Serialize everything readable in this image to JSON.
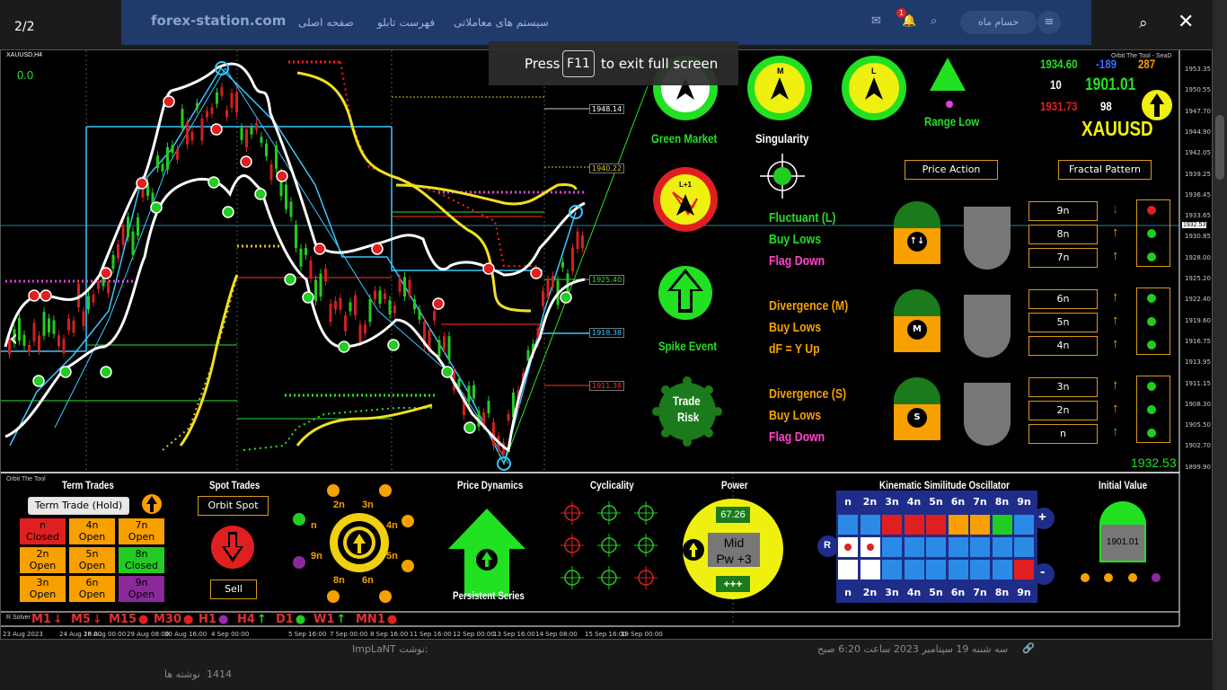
{
  "viewer": {
    "counter": "2/2",
    "fullscreen_press": "Press",
    "fullscreen_key": "F11",
    "fullscreen_rest": "to exit full screen"
  },
  "forum": {
    "logo": "forex-station.com",
    "nav": [
      "سیستم های معاملاتی",
      "فهرست تابلو",
      "صفحه اصلی"
    ],
    "user": "حسام ماه",
    "notif_count": "1",
    "post_meta": "سه شنبه 19 سپتامبر 2023 ساعت 6:20 صبح",
    "post_author": "ImpLaNT نوشت:",
    "side_label": "نوشته ها",
    "side_count": "1414"
  },
  "chart": {
    "symbol": "XAUUSD,H4",
    "value_readout": "0.0",
    "title_tag": "Orbit The Tool - SeaD",
    "price_boxes": [
      {
        "label": "1948.14",
        "color": "#ffffff"
      },
      {
        "label": "1940.22",
        "color": "#e0c020"
      },
      {
        "label": "1925.40",
        "color": "#2ee02e"
      },
      {
        "label": "1918.38",
        "color": "#38c8ff"
      },
      {
        "label": "1911.38",
        "color": "#ff3030"
      },
      {
        "label": "1932.53",
        "color": "#ffffff"
      }
    ],
    "axis_prices": [
      "1953.35",
      "1950.55",
      "1947.70",
      "1944.90",
      "1942.05",
      "1939.25",
      "1936.45",
      "1933.65",
      "1930.85",
      "1928.00",
      "1925.20",
      "1922.40",
      "1919.60",
      "1916.75",
      "1913.95",
      "1911.15",
      "1908.30",
      "1905.50",
      "1902.70",
      "1899.90"
    ],
    "current_price_axis": "1932.53",
    "time_labels": [
      "23 Aug 2023",
      "24 Aug 16:00",
      "28 Aug 00:00",
      "29 Aug 08:00",
      "30 Aug 16:00",
      "4 Sep 00:00",
      "5 Sep 16:00",
      "7 Sep 00:00",
      "8 Sep 16:00",
      "11 Sep 16:00",
      "12 Sep 00:00",
      "13 Sep 16:00",
      "14 Sep 08:00",
      "15 Sep 16:00",
      "19 Sep 00:00"
    ]
  },
  "panel": {
    "green_market": "Green Market",
    "singularity": "Singularity",
    "range_low": "Range Low",
    "spike_event": "Spike Event",
    "trade_risk": [
      "Trade",
      "Risk"
    ],
    "lp_label": "L+1",
    "m_label": "M",
    "l_label": "L",
    "q_top_left": "1934.60",
    "q_top_mid": "-189",
    "q_top_right": "287",
    "q_mid_left": "10",
    "q_mid_mid": "1901.01",
    "q_bot_left": "1931.73",
    "q_bot_mid": "98",
    "symbol": "XAUUSD",
    "price_action": "Price Action",
    "fractal_pattern": "Fractal Pattern",
    "groups": [
      {
        "lines": [
          "Fluctuant (L)",
          "Buy Lows",
          "Flag Down"
        ],
        "colors": [
          "#22dd22",
          "#22dd22",
          "#ff44cc"
        ],
        "icon": "↑↓",
        "boxes": [
          "9n",
          "8n",
          "7n"
        ]
      },
      {
        "lines": [
          "Divergence (M)",
          "Buy Lows",
          "dF = Y Up"
        ],
        "colors": [
          "#f7a000",
          "#f7a000",
          "#f7a000"
        ],
        "icon": "M",
        "boxes": [
          "6n",
          "5n",
          "4n"
        ]
      },
      {
        "lines": [
          "Divergence (S)",
          "Buy Lows",
          "Flag Down"
        ],
        "colors": [
          "#f7a000",
          "#f7a000",
          "#ff44cc"
        ],
        "icon": "S",
        "boxes": [
          "3n",
          "2n",
          "n"
        ]
      }
    ],
    "last_price": "1932.53"
  },
  "bottom": {
    "tool_name": "Orbit The Tool",
    "term_trades": {
      "title": "Term Trades",
      "button": "Term Trade (Hold)",
      "cells": [
        {
          "line1": "n",
          "line2": "Closed",
          "bg": "#e02020"
        },
        {
          "line1": "4n",
          "line2": "Open",
          "bg": "#f7a000"
        },
        {
          "line1": "7n",
          "line2": "Open",
          "bg": "#f7a000"
        },
        {
          "line1": "2n",
          "line2": "Open",
          "bg": "#f7a000"
        },
        {
          "line1": "5n",
          "line2": "Open",
          "bg": "#f7a000"
        },
        {
          "line1": "8n",
          "line2": "Closed",
          "bg": "#22cc22"
        },
        {
          "line1": "3n",
          "line2": "Open",
          "bg": "#f7a000"
        },
        {
          "line1": "6n",
          "line2": "Open",
          "bg": "#f7a000"
        },
        {
          "line1": "9n",
          "line2": "Open",
          "bg": "#8a2a9a"
        }
      ]
    },
    "spot_trades": {
      "title": "Spot Trades",
      "button": "Orbit Spot",
      "action": "Sell"
    },
    "orbit_labels": [
      "2n",
      "3n",
      "4n",
      "5n",
      "6n",
      "8n",
      "9n",
      "n"
    ],
    "price_dynamics": {
      "title": "Price Dynamics",
      "caption": "Persistent Series"
    },
    "cyclicality": {
      "title": "Cyclicality"
    },
    "power": {
      "title": "Power",
      "value": "67.26",
      "mid": "Mid",
      "pw": "Pw +3",
      "plus": "+++"
    },
    "kso": {
      "title": "Kinematic Similitude Oscillator",
      "header": [
        "n",
        "2n",
        "3n",
        "4n",
        "5n",
        "6n",
        "7n",
        "8n",
        "9n"
      ],
      "row1": [
        "#2b8ae6",
        "#2b8ae6",
        "#e02020",
        "#e02020",
        "#e02020",
        "#f7a000",
        "#f7a000",
        "#22cc22",
        "#2b8ae6"
      ],
      "row2": [
        "#ffffff",
        "#ffffff",
        "#2b8ae6",
        "#2b8ae6",
        "#2b8ae6",
        "#2b8ae6",
        "#2b8ae6",
        "#2b8ae6",
        "#2b8ae6"
      ],
      "row3": [
        "#ffffff",
        "#ffffff",
        "#2b8ae6",
        "#2b8ae6",
        "#2b8ae6",
        "#2b8ae6",
        "#2b8ae6",
        "#2b8ae6",
        "#e02020"
      ],
      "plus": "+",
      "minus": "-",
      "r": "R"
    },
    "initial_value": {
      "title": "Initial Value",
      "value": "1901.01"
    },
    "solver": "R Solver",
    "timeframes": [
      {
        "label": "M1",
        "mark": "↓",
        "color": "#e02020"
      },
      {
        "label": "M5",
        "mark": "↓",
        "color": "#e02020"
      },
      {
        "label": "M15",
        "mark": "●",
        "color": "#e02020"
      },
      {
        "label": "M30",
        "mark": "●",
        "color": "#e02020"
      },
      {
        "label": "H1",
        "mark": "●",
        "color": "#9a2ab0"
      },
      {
        "label": "H4",
        "mark": "↑",
        "color": "#22cc22"
      },
      {
        "label": "D1",
        "mark": "●",
        "color": "#22cc22"
      },
      {
        "label": "W1",
        "mark": "↑",
        "color": "#22cc22"
      },
      {
        "label": "MN1",
        "mark": "●",
        "color": "#e02020"
      }
    ]
  }
}
